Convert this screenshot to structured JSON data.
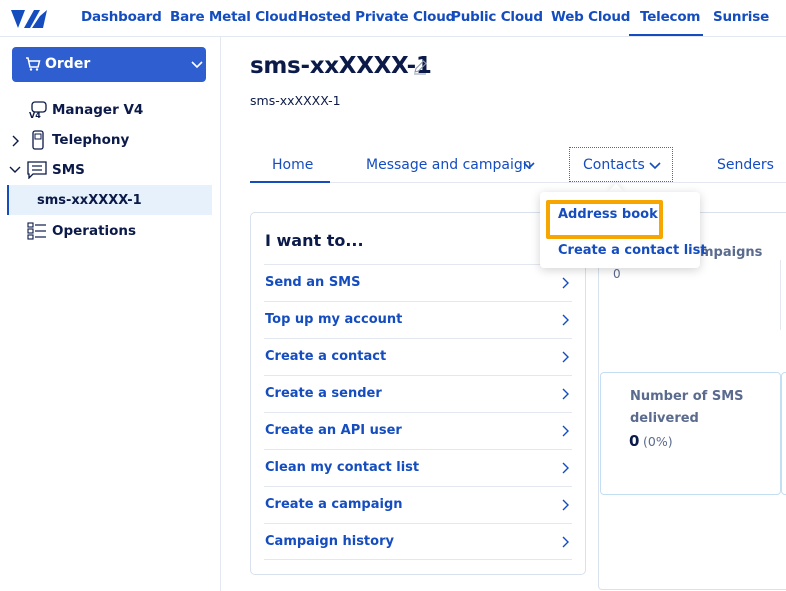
{
  "topnav": {
    "items": [
      "Dashboard",
      "Bare Metal Cloud",
      "Hosted Private Cloud",
      "Public Cloud",
      "Web Cloud",
      "Telecom",
      "Sunrise"
    ],
    "active": "Telecom"
  },
  "sidebar": {
    "order_label": "Order",
    "items": [
      {
        "label": "Manager V4",
        "icon": "manager-v4-icon"
      },
      {
        "label": "Telephony",
        "icon": "phone-icon"
      },
      {
        "label": "SMS",
        "icon": "sms-icon"
      },
      {
        "label": "sms-xxXXXX-1",
        "icon": ""
      },
      {
        "label": "Operations",
        "icon": "operations-icon"
      }
    ]
  },
  "header": {
    "title": "sms-xxXXXX-1",
    "subtitle": "sms-xxXXXX-1"
  },
  "tabs": [
    "Home",
    "Message and campaign",
    "Contacts",
    "Senders"
  ],
  "card": {
    "title": "I want to...",
    "items": [
      "Send an SMS",
      "Top up my account",
      "Create a contact",
      "Create a sender",
      "Create an API user",
      "Clean my contact list",
      "Create a campaign",
      "Campaign history"
    ]
  },
  "panels": {
    "campaigns_partial": "mpaigns",
    "campaigns_value": "0",
    "delivered_line1": "Number of SMS",
    "delivered_line2": "delivered",
    "delivered_value": "0",
    "delivered_pct": "(0%)"
  },
  "dropdown": {
    "items": [
      "Address book",
      "Create a contact list"
    ]
  },
  "colors": {
    "primary": "#154dbf",
    "order_button": "#2e5ecf",
    "highlight": "#f7a600",
    "text_dark": "#0b1a48"
  }
}
